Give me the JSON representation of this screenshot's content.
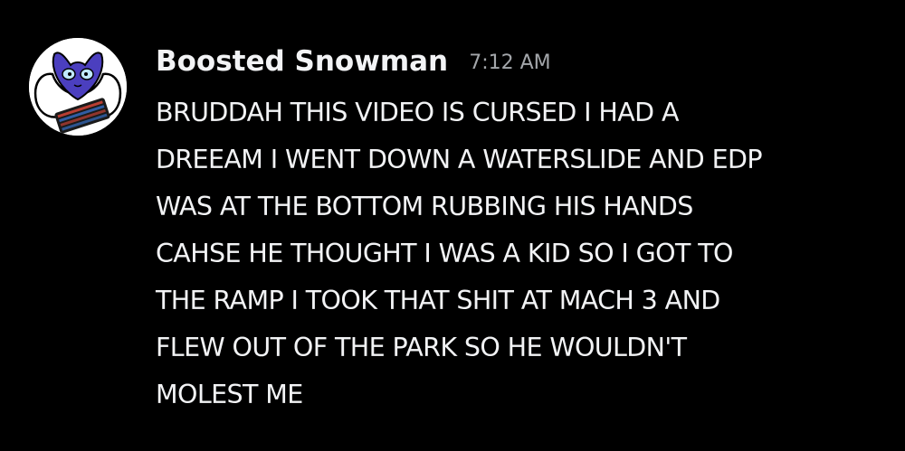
{
  "message": {
    "author": "Boosted Snowman",
    "timestamp": "7:12 AM",
    "lines": [
      "BRUDDAH THIS VIDEO IS CURSED I HAD A",
      "DREEAM I WENT DOWN A WATERSLIDE AND EDP",
      "WAS AT THE BOTTOM RUBBING HIS HANDS",
      "CAHSE HE THOUGHT I WAS A KID SO I GOT TO",
      "THE RAMP I TOOK THAT SHIT AT MACH 3 AND",
      "FLEW OUT OF THE PARK SO HE WOULDN'T",
      "MOLEST ME"
    ]
  },
  "avatar": {
    "icon": "character-at-keyboard-avatar",
    "colors": {
      "background": "#ffffff",
      "character": "#4b3fbf",
      "outline": "#000000",
      "keyboard": "#1a1a1a",
      "keys_accent": "#e0473a"
    }
  },
  "theme": {
    "background": "#000000",
    "text": "#f2f3f5",
    "muted": "#a3a6aa"
  }
}
